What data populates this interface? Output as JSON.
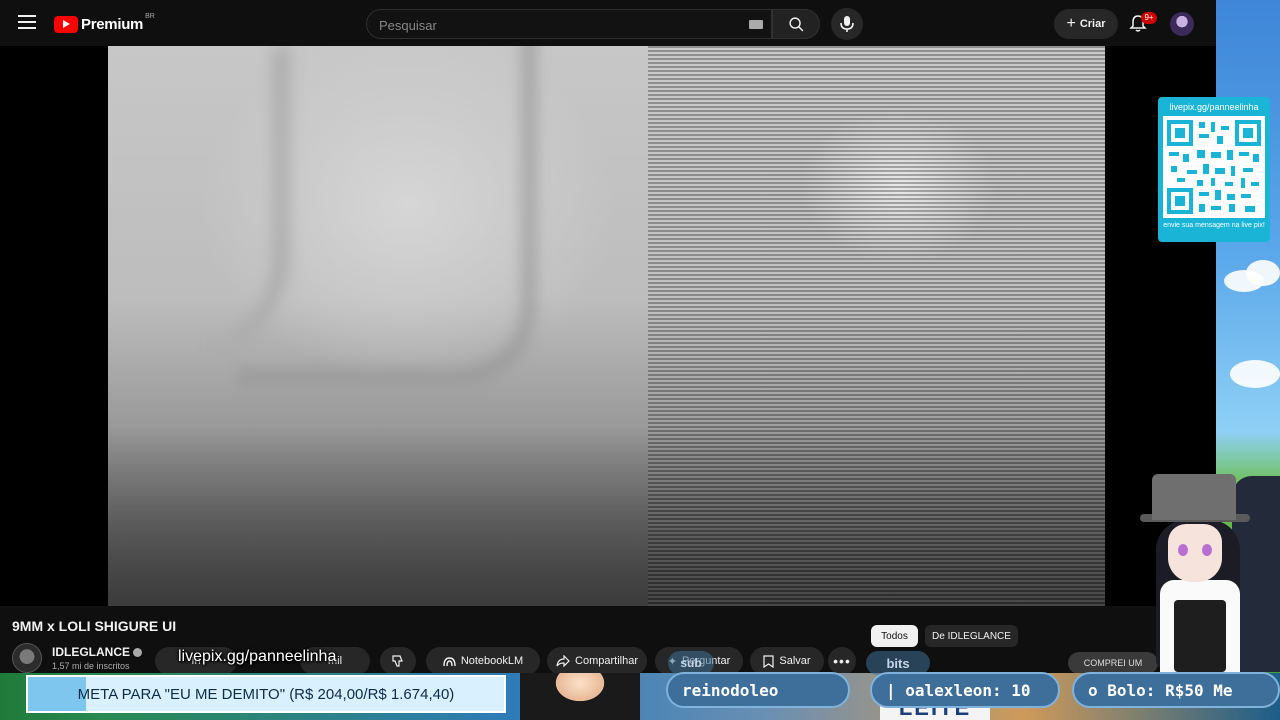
{
  "header": {
    "logo_text": "Premium",
    "country_code": "BR",
    "search_placeholder": "Pesquisar",
    "create_label": "Criar",
    "notif_count": "9+"
  },
  "livepix": {
    "url": "livepix.gg/panneelinha",
    "message": "envie sua mensagem na live pix!"
  },
  "video": {
    "title": "9MM x LOLI SHIGURE UI",
    "channel": "IDLEGLANCE",
    "subscribers": "1,57 mi de inscritos"
  },
  "actions": {
    "join": "In",
    "like": "mil",
    "notebook": "NotebookLM",
    "share": "Compartilhar",
    "ask": "Perguntar",
    "save": "Salvar",
    "more": "•••"
  },
  "chat_chips": {
    "all": "Todos",
    "from": "De IDLEGLANCE",
    "buy": "COMPREI UM"
  },
  "overlay": {
    "url": "livepix.gg/panneelinha",
    "goal_text": "META PARA \"EU ME DEMITO\" (R$ 204,00/R$ 1.674,40)",
    "goal_progress": 0.1218,
    "ticker": [
      "reinodoleo",
      "| oalexleon: 10",
      "o Bolo: R$50  Me"
    ],
    "bits": "bits",
    "sub": "sub",
    "leite": "LEITE"
  },
  "colors": {
    "accent": "#ff0000",
    "livepix": "#1ab4d6",
    "goal_fill": "#7fc6ef"
  }
}
